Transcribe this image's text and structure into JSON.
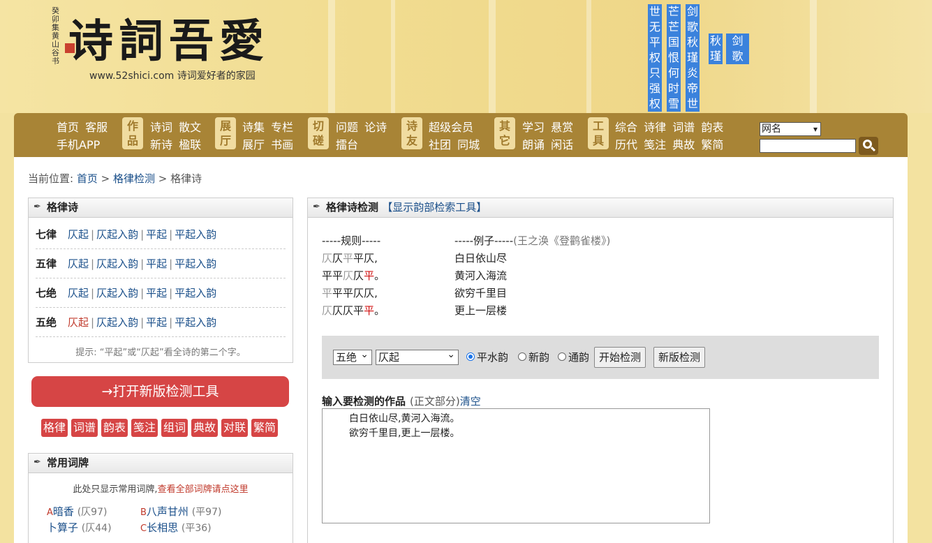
{
  "header": {
    "seal_text": "癸卯集黄山谷书",
    "logo": "诗詞吾愛",
    "tagline": "www.52shici.com 诗词爱好者的家园",
    "vertical_columns": [
      [
        "世",
        "无",
        "平",
        "权",
        "只",
        "强",
        "权"
      ],
      [
        "芒",
        "芒",
        "国",
        "恨",
        "何",
        "时",
        "雪"
      ],
      [
        "剑",
        "歌",
        "秋",
        "瑾",
        "炎",
        "帝",
        "世"
      ],
      [
        "秋",
        "瑾"
      ],
      [
        "剑",
        "歌"
      ]
    ]
  },
  "nav": {
    "group0": {
      "row1": [
        "首页",
        "客服"
      ],
      "row2": [
        "手机APP"
      ]
    },
    "group1": {
      "badge": [
        "作",
        "品"
      ],
      "row1": [
        "诗词",
        "散文"
      ],
      "row2": [
        "新诗",
        "楹联"
      ]
    },
    "group2": {
      "badge": [
        "展",
        "厅"
      ],
      "row1": [
        "诗集",
        "专栏"
      ],
      "row2": [
        "展厅",
        "书画"
      ]
    },
    "group3": {
      "badge": [
        "切",
        "磋"
      ],
      "row1": [
        "问题",
        "论诗"
      ],
      "row2": [
        "擂台"
      ]
    },
    "group4": {
      "badge": [
        "诗",
        "友"
      ],
      "row1": [
        "超级会员"
      ],
      "row2": [
        "社团",
        "同城"
      ]
    },
    "group5": {
      "badge": [
        "其",
        "它"
      ],
      "row1": [
        "学习",
        "悬赏"
      ],
      "row2": [
        "朗诵",
        "闲话"
      ]
    },
    "group6": {
      "badge": [
        "工",
        "具"
      ],
      "row1": [
        "综合",
        "诗律",
        "词谱",
        "韵表"
      ],
      "row2": [
        "历代",
        "笺注",
        "典故",
        "繁简"
      ]
    },
    "search_select": "网名"
  },
  "breadcrumb": {
    "label": "当前位置:",
    "home": "首页",
    "sep": ">",
    "section": "格律检测",
    "current": "格律诗"
  },
  "left_panel": {
    "title": "格律诗",
    "rows": [
      {
        "name": "七律",
        "links": [
          "仄起",
          "仄起入韵",
          "平起",
          "平起入韵"
        ]
      },
      {
        "name": "五律",
        "links": [
          "仄起",
          "仄起入韵",
          "平起",
          "平起入韵"
        ]
      },
      {
        "name": "七绝",
        "links": [
          "仄起",
          "仄起入韵",
          "平起",
          "平起入韵"
        ]
      },
      {
        "name": "五绝",
        "links": [
          "仄起",
          "仄起入韵",
          "平起",
          "平起入韵"
        ]
      }
    ],
    "separator": "|",
    "hint": "提示: “平起”或“仄起”看全诗的第二个字。"
  },
  "open_new_tool": "→打开新版检测工具",
  "tools": [
    "格律",
    "词谱",
    "韵表",
    "笺注",
    "组词",
    "典故",
    "对联",
    "繁简"
  ],
  "cipai_panel": {
    "title": "常用词牌",
    "note": "此处只显示常用词牌,",
    "note_link": "查看全部词牌请点这里",
    "items": [
      {
        "letter": "A",
        "name": "暗香",
        "meter": "(仄97)"
      },
      {
        "letter": "B",
        "name": "八声甘州",
        "meter": "(平97)"
      },
      {
        "letter": "",
        "name": "卜算子",
        "meter": "(仄44)"
      },
      {
        "letter": "C",
        "name": "长相思",
        "meter": "(平36)"
      }
    ]
  },
  "check_panel": {
    "title": "格律诗检测",
    "link": "【显示韵部检索工具】",
    "rule_head": "-----规则-----",
    "example_head": "-----例子-----",
    "example_src": "(王之涣《登鹳雀楼》)",
    "rule_lines": [
      [
        [
          "仄",
          "g"
        ],
        [
          "仄",
          ""
        ],
        [
          "平",
          "g"
        ],
        [
          "平",
          ""
        ],
        [
          "仄",
          ""
        ],
        [
          ",",
          ""
        ]
      ],
      [
        [
          "平",
          ""
        ],
        [
          "平",
          ""
        ],
        [
          "仄",
          "g"
        ],
        [
          "仄",
          ""
        ],
        [
          "平",
          "r"
        ],
        [
          "。",
          ""
        ]
      ],
      [
        [
          "平",
          "g"
        ],
        [
          "平",
          ""
        ],
        [
          "平",
          ""
        ],
        [
          "仄",
          ""
        ],
        [
          "仄",
          ""
        ],
        [
          ",",
          ""
        ]
      ],
      [
        [
          "仄",
          "g"
        ],
        [
          "仄",
          ""
        ],
        [
          "仄",
          ""
        ],
        [
          "平",
          ""
        ],
        [
          "平",
          "r"
        ],
        [
          "。",
          ""
        ]
      ]
    ],
    "example_lines": [
      "白日依山尽",
      "黄河入海流",
      "欲穷千里目",
      "更上一层楼"
    ],
    "form_select": "五绝",
    "start_select": "仄起",
    "rhyme_options": [
      "平水韵",
      "新韵",
      "通韵"
    ],
    "btn_start": "开始检测",
    "btn_new": "新版检测",
    "input_label": "输入要检测的作品",
    "input_sub": "(正文部分)",
    "clear": "清空",
    "work_text": "　　白日依山尽,黄河入海流。\n　　欲穷千里目,更上一层楼。"
  },
  "colors": {
    "nav": "#a88436",
    "accent_red": "#d64545",
    "link": "#1a4f8a",
    "vertical_blue": "#3b82dc"
  }
}
